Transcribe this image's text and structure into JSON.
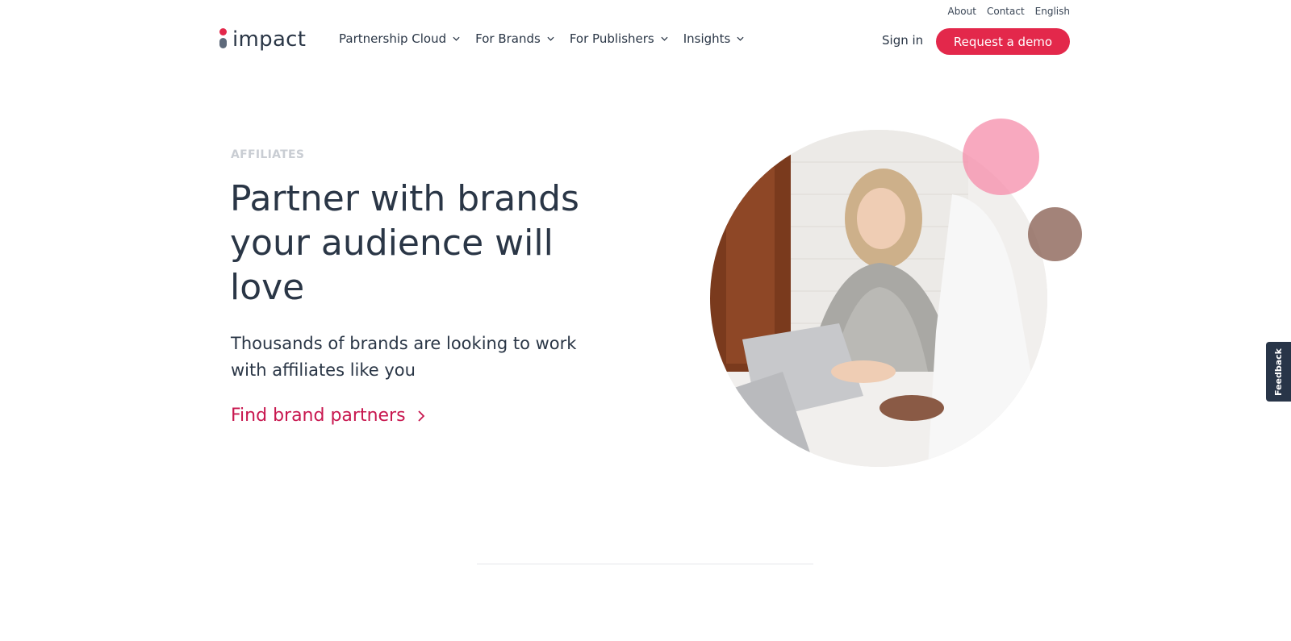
{
  "util_nav": {
    "about": "About",
    "contact": "Contact",
    "language": "English"
  },
  "header": {
    "logo_text": "impact",
    "nav": [
      {
        "label": "Partnership Cloud",
        "icon": "chevron-down-icon"
      },
      {
        "label": "For Brands",
        "icon": "chevron-down-icon"
      },
      {
        "label": "For Publishers",
        "icon": "chevron-down-icon"
      },
      {
        "label": "Insights",
        "icon": "chevron-down-icon"
      }
    ],
    "sign_in": "Sign in",
    "demo_button": "Request a demo"
  },
  "hero": {
    "eyebrow": "AFFILIATES",
    "headline": "Partner with brands your audience will love",
    "subhead": "Thousands of brands are looking to work with affiliates like you",
    "cta": "Find brand partners",
    "cta_icon": "chevron-right-icon"
  },
  "feedback": "Feedback",
  "colors": {
    "brand_red": "#e3284b",
    "cta_text": "#c8174f",
    "text_dark": "#2a3646",
    "pink_circle": "#f58caa",
    "brown_circle": "#8c6458",
    "feedback_bg": "#283548"
  }
}
